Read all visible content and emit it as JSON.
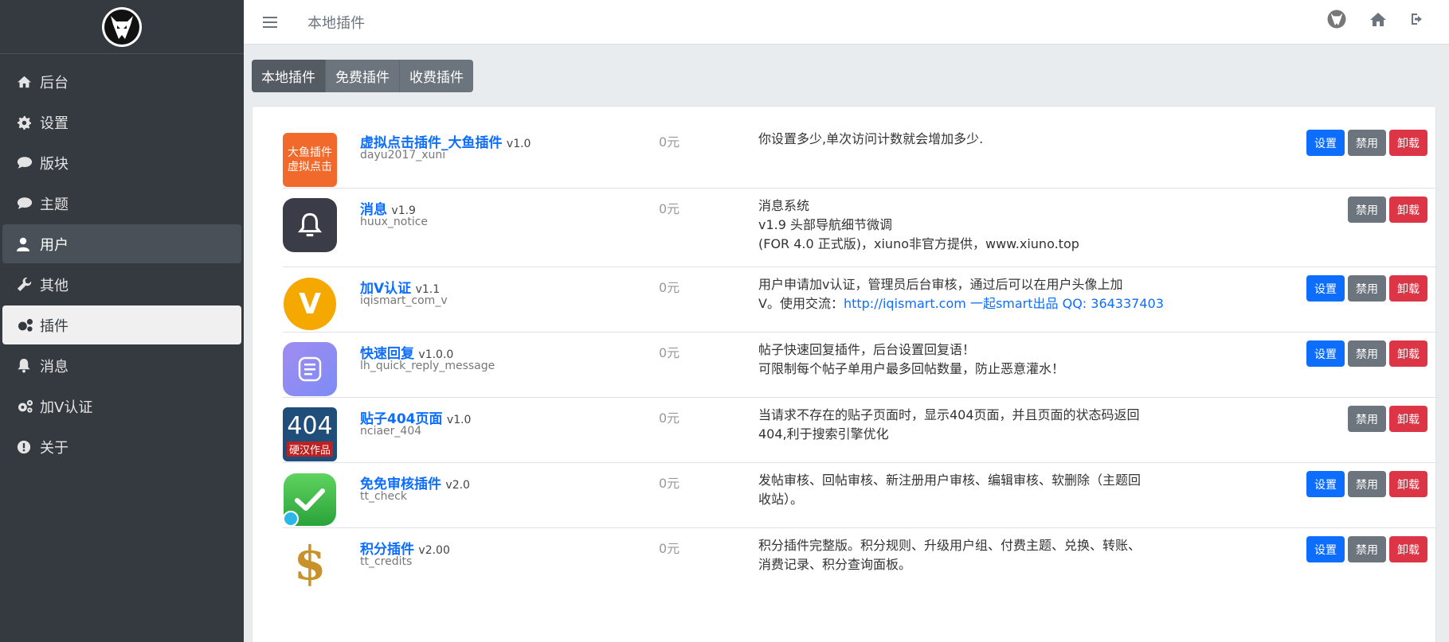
{
  "header": {
    "title": "本地插件"
  },
  "sidebar": {
    "items": [
      {
        "label": "后台",
        "icon": "home-icon"
      },
      {
        "label": "设置",
        "icon": "gear-icon"
      },
      {
        "label": "版块",
        "icon": "comment-icon"
      },
      {
        "label": "主题",
        "icon": "comment-icon"
      },
      {
        "label": "用户",
        "icon": "user-icon"
      },
      {
        "label": "其他",
        "icon": "wrench-icon"
      },
      {
        "label": "插件",
        "icon": "cogs-icon"
      },
      {
        "label": "消息",
        "icon": "bell-icon"
      },
      {
        "label": "加V认证",
        "icon": "cogs-icon"
      },
      {
        "label": "关于",
        "icon": "info-icon"
      }
    ]
  },
  "tabs": [
    {
      "label": "本地插件"
    },
    {
      "label": "免费插件"
    },
    {
      "label": "收费插件"
    }
  ],
  "buttons": {
    "settings": "设置",
    "disable": "禁用",
    "uninstall": "卸载"
  },
  "plugins": [
    {
      "name": "虚拟点击插件_大鱼插件",
      "version": "v1.0",
      "id": "dayu2017_xuni",
      "price": "0元",
      "desc": [
        "你设置多少,单次访问计数就会增加多少."
      ],
      "link": "",
      "link_rest": "",
      "thumb": {
        "type": "text",
        "lines": [
          "大鱼插件",
          "虚拟点击"
        ],
        "bg": "#f26a2b"
      },
      "has_settings": true
    },
    {
      "name": "消息",
      "version": "v1.9",
      "id": "huux_notice",
      "price": "0元",
      "desc": [
        "消息系统",
        "v1.9 头部导航细节微调",
        "(FOR 4.0 正式版)，xiuno非官方提供，www.xiuno.top"
      ],
      "link": "",
      "link_rest": "",
      "thumb": {
        "type": "bell",
        "bg": "#3a3d47"
      },
      "has_settings": false
    },
    {
      "name": "加V认证",
      "version": "v1.1",
      "id": "iqismart_com_v",
      "price": "0元",
      "desc": [
        "用户申请加v认证，管理员后台审核，通过后可以在用户头像上加",
        "V。使用交流："
      ],
      "link": "http://iqismart.com 一起smart出品 QQ: 364337403",
      "link_rest": "",
      "thumb": {
        "type": "v",
        "letter": "V",
        "bg": "#f5a800"
      },
      "has_settings": true
    },
    {
      "name": "快速回复",
      "version": "v1.0.0",
      "id": "lh_quick_reply_message",
      "price": "0元",
      "desc": [
        "帖子快速回复插件，后台设置回复语！",
        "可限制每个帖子单用户最多回帖数量，防止恶意灌水！"
      ],
      "link": "",
      "link_rest": "",
      "thumb": {
        "type": "doc",
        "bg": "#8a86f2"
      },
      "has_settings": true
    },
    {
      "name": "贴子404页面",
      "version": "v1.0",
      "id": "nciaer_404",
      "price": "0元",
      "desc": [
        "当请求不存在的贴子页面时，显示404页面，并且页面的状态码返回",
        "404,利于搜索引擎优化"
      ],
      "link": "",
      "link_rest": "",
      "thumb": {
        "type": "404",
        "big": "404",
        "small": "硬汉作品",
        "bg": "#1f4e7a"
      },
      "has_settings": false
    },
    {
      "name": "免免审核插件",
      "version": "v2.0",
      "id": "tt_check",
      "price": "0元",
      "desc": [
        "发帖审核、回帖审核、新注册用户审核、编辑审核、软删除（主题回",
        "收站）。"
      ],
      "link": "",
      "link_rest": "",
      "thumb": {
        "type": "check",
        "bg": "#3ec04a"
      },
      "has_settings": true
    },
    {
      "name": "积分插件",
      "version": "v2.00",
      "id": "tt_credits",
      "price": "0元",
      "desc": [
        "积分插件完整版。积分规则、升级用户组、付费主题、兑换、转账、",
        "消费记录、积分查询面板。"
      ],
      "link": "",
      "link_rest": "",
      "thumb": {
        "type": "dollar",
        "symbol": "$",
        "bg": "#ffffff"
      },
      "has_settings": true
    }
  ]
}
